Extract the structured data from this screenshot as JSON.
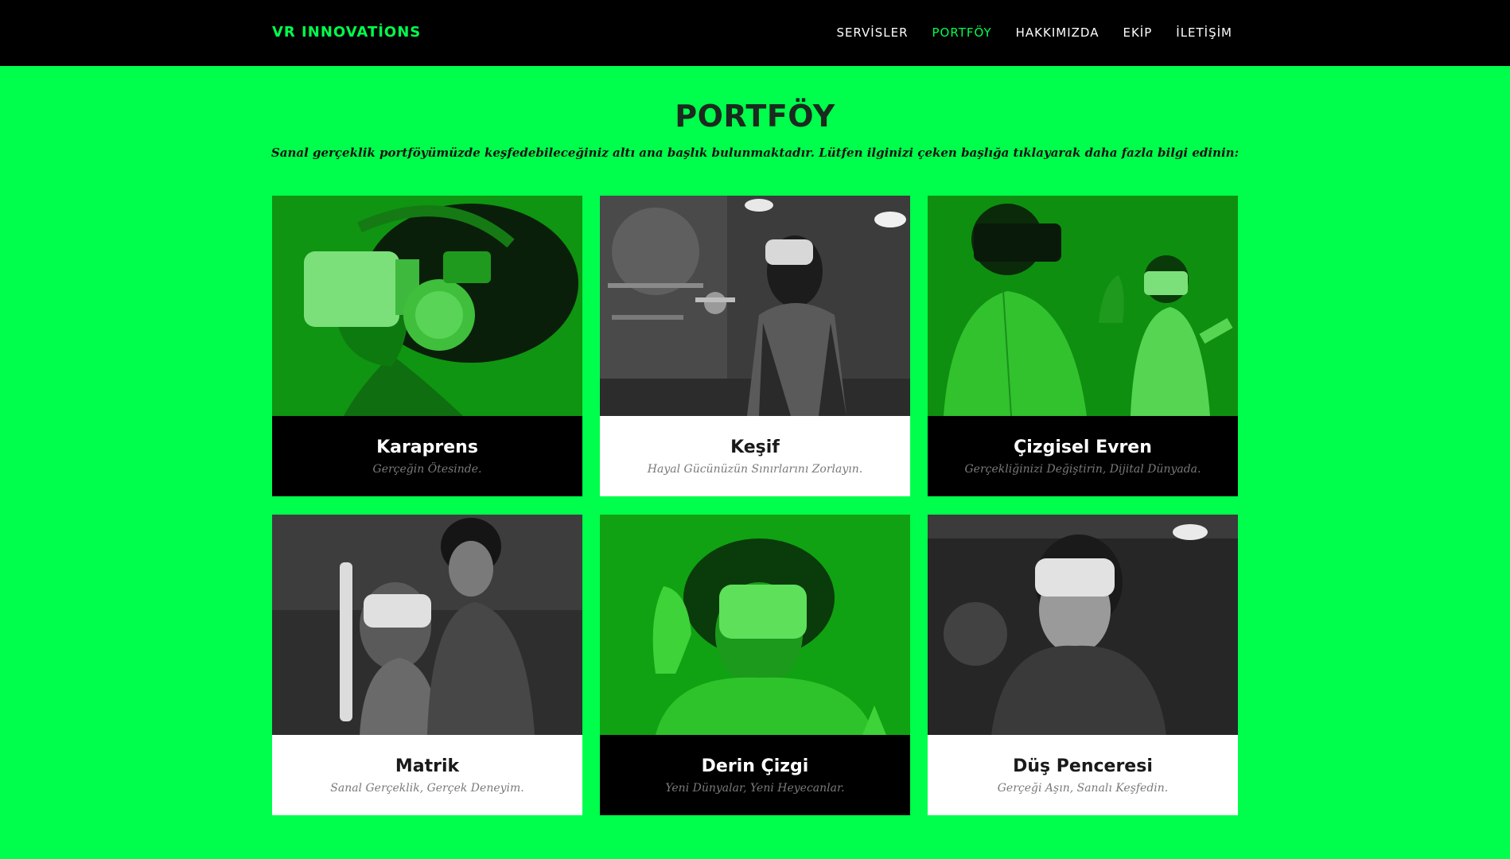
{
  "navbar": {
    "brand": "VR INNOVATİONS",
    "links": [
      {
        "label": "SERVİSLER",
        "active": false
      },
      {
        "label": "PORTFÖY",
        "active": true
      },
      {
        "label": "HAKKIMIZDA",
        "active": false
      },
      {
        "label": "EKİP",
        "active": false
      },
      {
        "label": "İLETİŞİM",
        "active": false
      }
    ]
  },
  "portfolio": {
    "title": "PORTFÖY",
    "subtitle": "Sanal gerçeklik portföyümüzde keşfedebileceğiniz altı ana başlık bulunmaktadır. Lütfen ilginizi çeken başlığa tıklayarak daha fazla bilgi edinin:",
    "items": [
      {
        "title": "Karaprens",
        "tagline": "Gerçeğin Ötesinde.",
        "caption_style": "dark",
        "image_tone": "green"
      },
      {
        "title": "Keşif",
        "tagline": "Hayal Gücünüzün Sınırlarını Zorlayın.",
        "caption_style": "light",
        "image_tone": "gray"
      },
      {
        "title": "Çizgisel Evren",
        "tagline": "Gerçekliğinizi Değiştirin, Dijital Dünyada.",
        "caption_style": "dark",
        "image_tone": "green"
      },
      {
        "title": "Matrik",
        "tagline": "Sanal Gerçeklik, Gerçek Deneyim.",
        "caption_style": "light",
        "image_tone": "gray"
      },
      {
        "title": "Derin Çizgi",
        "tagline": "Yeni Dünyalar, Yeni Heyecanlar.",
        "caption_style": "dark",
        "image_tone": "green"
      },
      {
        "title": "Düş Penceresi",
        "tagline": "Gerçeği Aşın, Sanalı Keşfedin.",
        "caption_style": "light",
        "image_tone": "gray"
      }
    ]
  },
  "colors": {
    "accent": "#00ff4c",
    "navbar_bg": "#000000",
    "heading": "#1a2a1e"
  }
}
